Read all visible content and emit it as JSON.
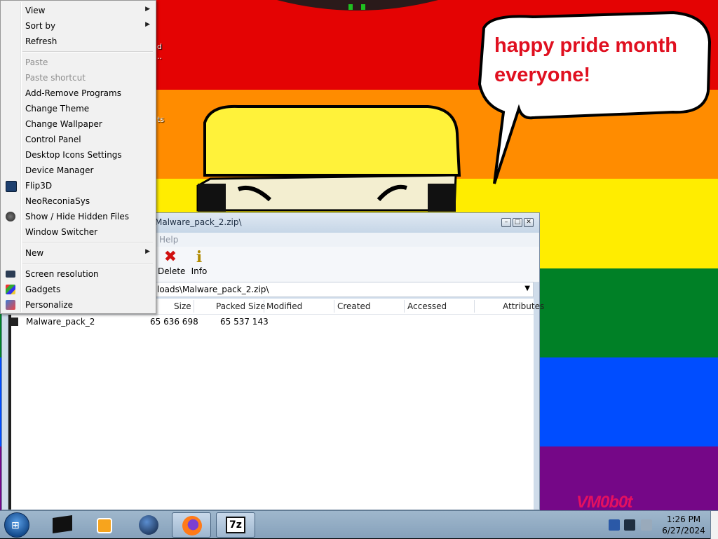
{
  "wallpaper": {
    "speech_bubble": "happy pride month everyone!",
    "watermark": "VM0b0t"
  },
  "desktop_fragments": [
    "d",
    "..",
    "ts"
  ],
  "context_menu": {
    "items": [
      {
        "label": "View",
        "submenu": true,
        "disabled": false
      },
      {
        "label": "Sort by",
        "submenu": true,
        "disabled": false
      },
      {
        "label": "Refresh",
        "submenu": false,
        "disabled": false
      },
      {
        "label": "Paste",
        "submenu": false,
        "disabled": true
      },
      {
        "label": "Paste shortcut",
        "submenu": false,
        "disabled": true
      },
      {
        "label": "Add-Remove Programs",
        "submenu": false,
        "disabled": false
      },
      {
        "label": "Change Theme",
        "submenu": false,
        "disabled": false
      },
      {
        "label": "Change Wallpaper",
        "submenu": false,
        "disabled": false
      },
      {
        "label": "Control Panel",
        "submenu": false,
        "disabled": false
      },
      {
        "label": "Desktop Icons Settings",
        "submenu": false,
        "disabled": false
      },
      {
        "label": "Device Manager",
        "submenu": false,
        "disabled": false
      },
      {
        "label": "Flip3D",
        "submenu": false,
        "disabled": false,
        "icon": "flip3d-icon"
      },
      {
        "label": "NeoReconiaSys",
        "submenu": false,
        "disabled": false
      },
      {
        "label": "Show / Hide Hidden Files",
        "submenu": false,
        "disabled": false,
        "icon": "hidden-files-icon"
      },
      {
        "label": "Window Switcher",
        "submenu": false,
        "disabled": false
      },
      {
        "label": "New",
        "submenu": true,
        "disabled": false
      },
      {
        "label": "Screen resolution",
        "submenu": false,
        "disabled": false,
        "icon": "monitor-icon"
      },
      {
        "label": "Gadgets",
        "submenu": false,
        "disabled": false,
        "icon": "gadgets-icon"
      },
      {
        "label": "Personalize",
        "submenu": false,
        "disabled": false,
        "icon": "personalize-icon"
      }
    ]
  },
  "archive_window": {
    "title": "Malware_pack_2.zip\\",
    "menu_help": "Help",
    "toolbar": {
      "delete_label": "Delete",
      "info_label": "Info"
    },
    "address": "loads\\Malware_pack_2.zip\\",
    "columns": [
      "Size",
      "Packed Size",
      "Modified",
      "Created",
      "Accessed",
      "Attributes"
    ],
    "rows": [
      {
        "name": "Malware_pack_2",
        "size": "65 636 698",
        "packed_size": "65 537 143",
        "modified": "",
        "created": "",
        "accessed": "",
        "attributes": ""
      }
    ]
  },
  "taskbar": {
    "apps": [
      "terminal-icon",
      "media-player-icon",
      "network-globe-icon",
      "firefox-icon",
      "7zip-icon"
    ],
    "active_apps": [
      "firefox-icon",
      "7zip-icon"
    ],
    "clock_time": "1:26 PM",
    "clock_date": "6/27/2024"
  }
}
